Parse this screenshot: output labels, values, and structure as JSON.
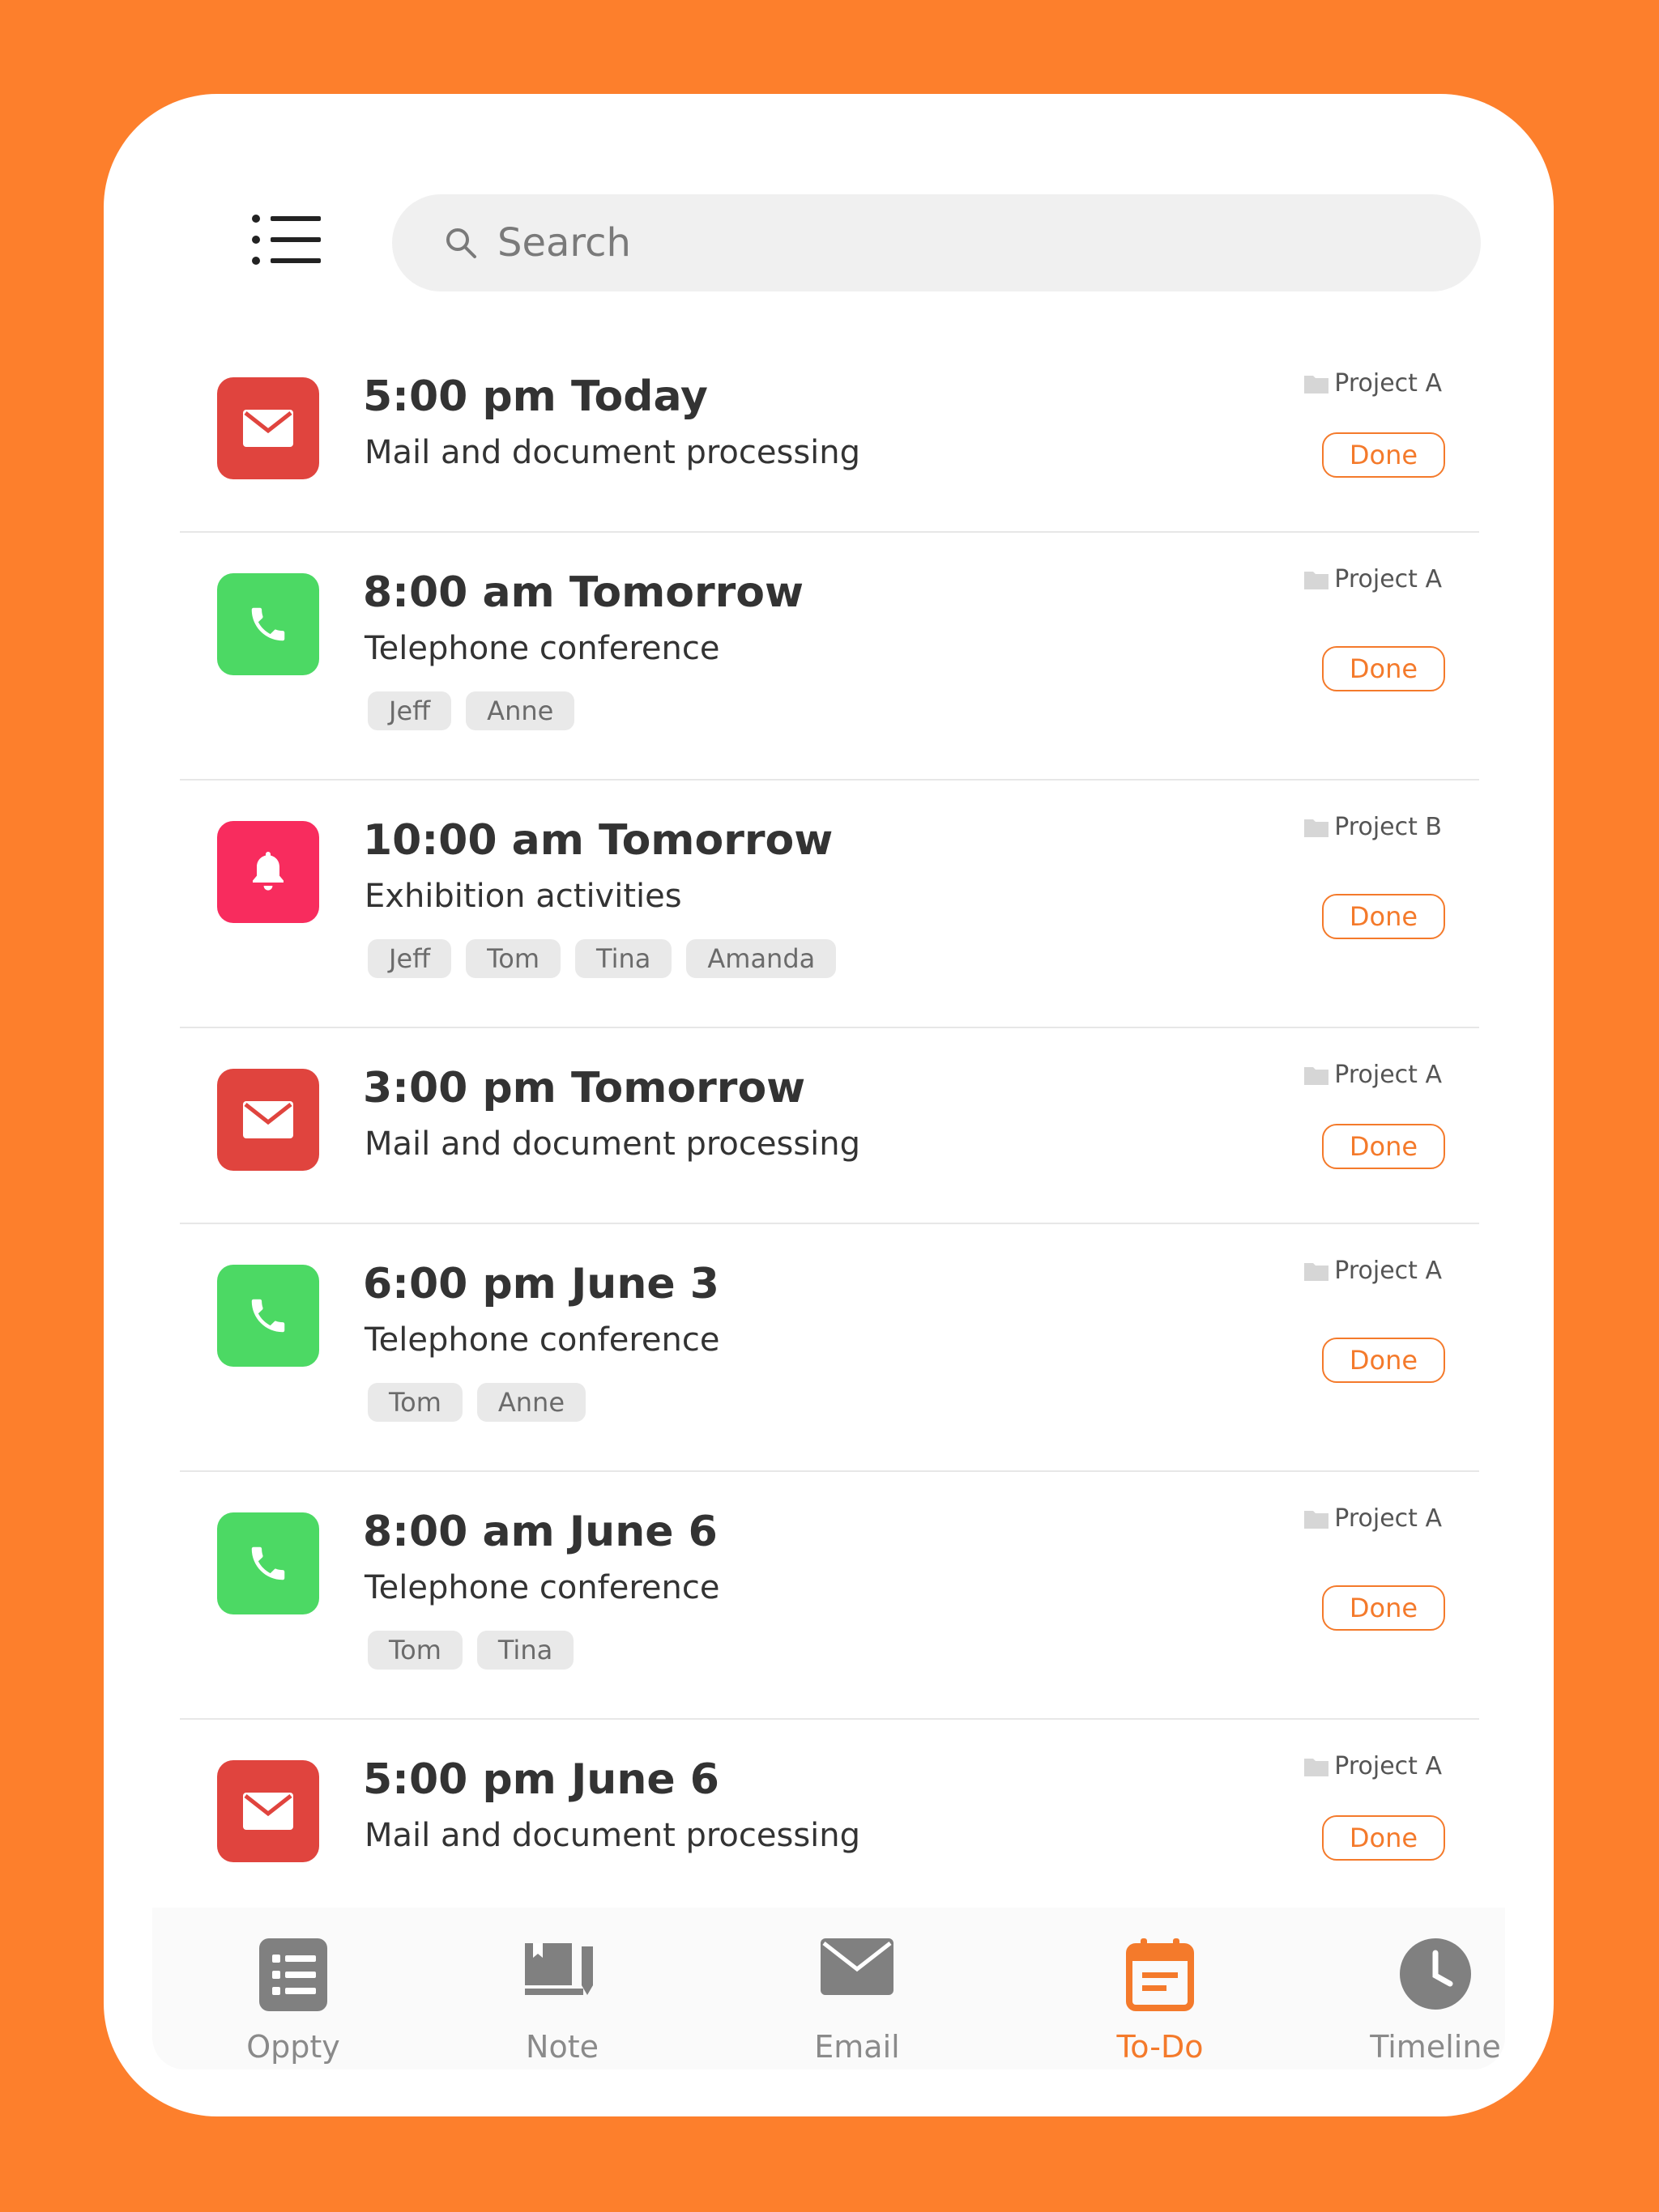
{
  "search": {
    "placeholder": "Search"
  },
  "done_label": "Done",
  "tasks": [
    {
      "type": "mail",
      "time": "5:00 pm Today",
      "desc": "Mail and document processing",
      "project": "Project A",
      "tags": []
    },
    {
      "type": "phone",
      "time": "8:00 am Tomorrow",
      "desc": "Telephone conference",
      "project": "Project A",
      "tags": [
        "Jeff",
        "Anne"
      ]
    },
    {
      "type": "alarm",
      "time": "10:00 am Tomorrow",
      "desc": "Exhibition activities",
      "project": "Project B",
      "tags": [
        "Jeff",
        "Tom",
        "Tina",
        "Amanda"
      ]
    },
    {
      "type": "mail",
      "time": "3:00 pm Tomorrow",
      "desc": "Mail and document processing",
      "project": "Project A",
      "tags": []
    },
    {
      "type": "phone",
      "time": "6:00 pm June 3",
      "desc": "Telephone conference",
      "project": "Project A",
      "tags": [
        "Tom",
        "Anne"
      ]
    },
    {
      "type": "phone",
      "time": "8:00 am June 6",
      "desc": "Telephone conference",
      "project": "Project A",
      "tags": [
        "Tom",
        "Tina"
      ]
    },
    {
      "type": "mail",
      "time": "5:00 pm June 6",
      "desc": "Mail and document processing",
      "project": "Project A",
      "tags": []
    }
  ],
  "tabs": [
    {
      "label": "Oppty",
      "icon": "list-icon"
    },
    {
      "label": "Note",
      "icon": "note-icon"
    },
    {
      "label": "Email",
      "icon": "email-icon"
    },
    {
      "label": "To-Do",
      "icon": "calendar-icon",
      "active": true
    },
    {
      "label": "Timeline",
      "icon": "clock-icon"
    }
  ],
  "colors": {
    "background": "#FD7F2C",
    "accent": "#F47A2B",
    "mail_icon_bg": "#E0443E",
    "phone_icon_bg": "#4CD964",
    "alarm_icon_bg": "#F82C5E"
  }
}
